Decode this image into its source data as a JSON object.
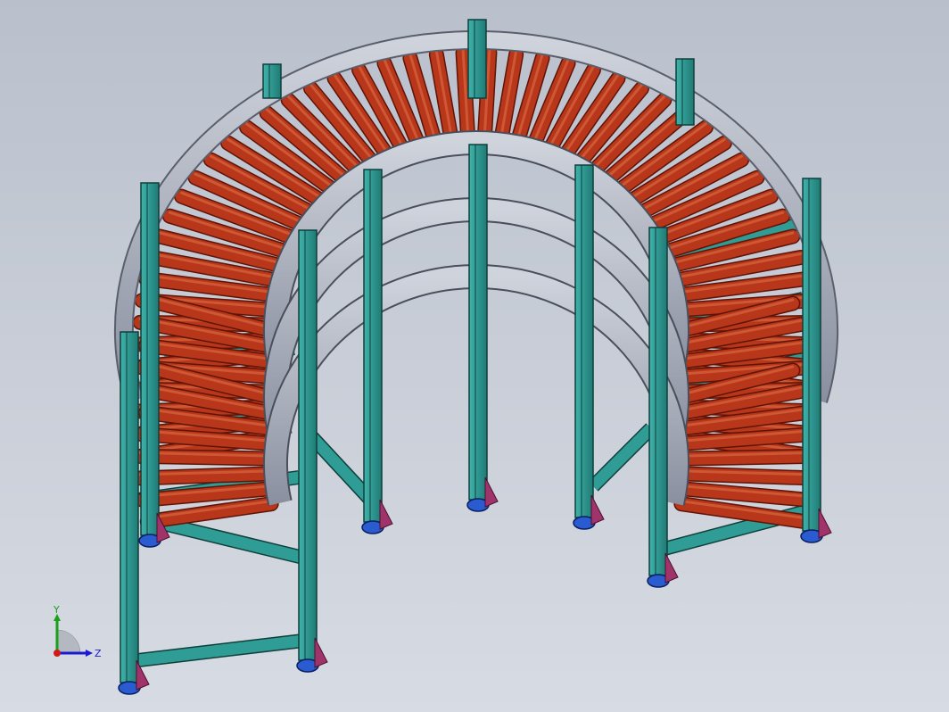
{
  "viewport": {
    "background_top": "#b9c0cc",
    "background_bottom": "#d7dbe3"
  },
  "model": {
    "description_tag": "curved-roller-conveyor",
    "roller_color": "#b8361a",
    "frame_color": "#9aa0ad",
    "leg_color": "#2f9c95",
    "foot_color": "#2a5bd0",
    "bracket_color": "#a0336a"
  },
  "triad": {
    "y_label": "Y",
    "z_label": "Z",
    "y_color": "#1aa01a",
    "z_color": "#1a1ad0",
    "origin_color": "#d01a1a"
  }
}
